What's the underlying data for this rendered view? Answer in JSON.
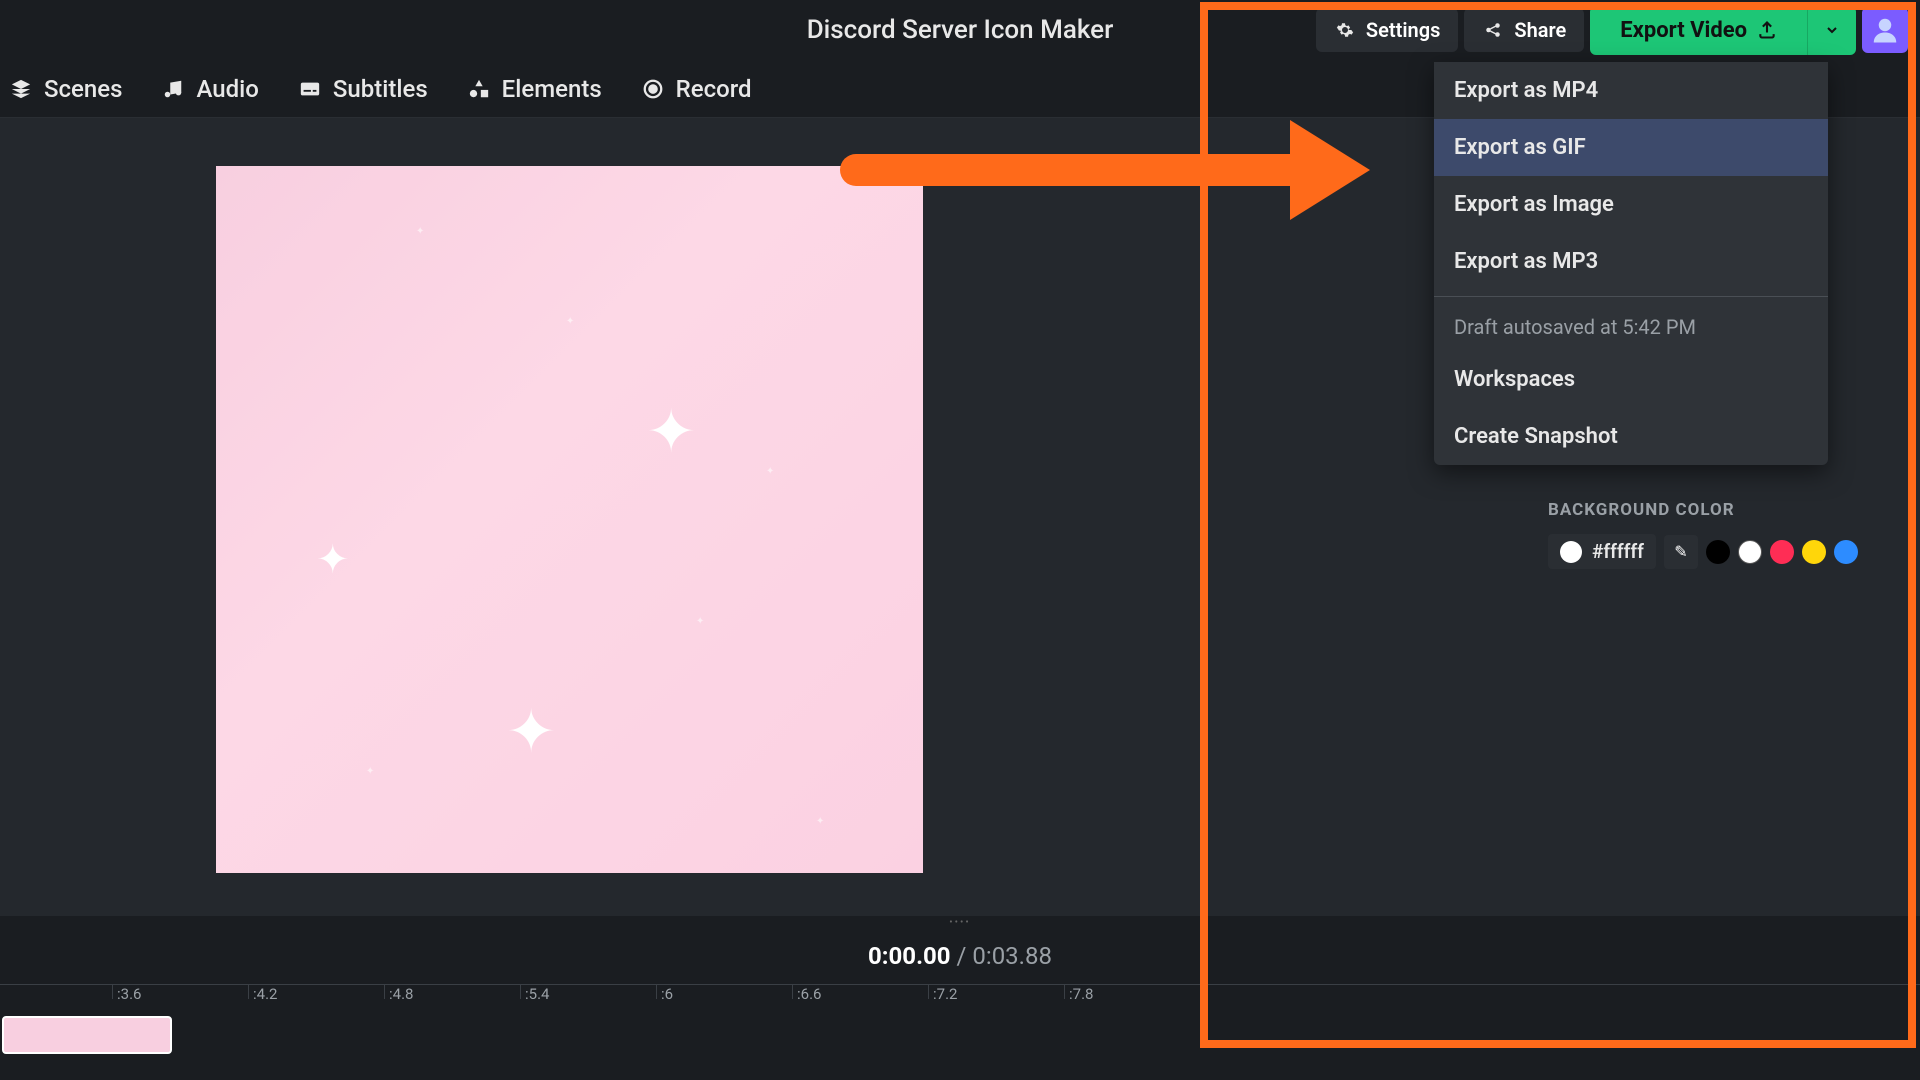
{
  "title": "Discord Server Icon Maker",
  "topButtons": {
    "settings": "Settings",
    "share": "Share",
    "export": "Export Video"
  },
  "nav": {
    "scenes": "Scenes",
    "audio": "Audio",
    "subtitles": "Subtitles",
    "elements": "Elements",
    "record": "Record"
  },
  "dropdown": {
    "mp4": "Export as MP4",
    "gif": "Export as GIF",
    "image": "Export as Image",
    "mp3": "Export as MP3",
    "autosave": "Draft autosaved at 5:42 PM",
    "workspaces": "Workspaces",
    "snapshot": "Create Snapshot"
  },
  "timeline": {
    "current": "0:00.00",
    "sep": " / ",
    "total": "0:03.88",
    "ticks": [
      ":3.6",
      ":4.2",
      ":4.8",
      ":5.4",
      ":6",
      ":6.6",
      ":7.2",
      ":7.8"
    ]
  },
  "rightPanel": {
    "bgLabel": "BACKGROUND COLOR",
    "hex": "#ffffff",
    "presets": [
      "#000000",
      "#ffffff",
      "#ff2d55",
      "#ffd60a",
      "#2d8cff"
    ]
  }
}
